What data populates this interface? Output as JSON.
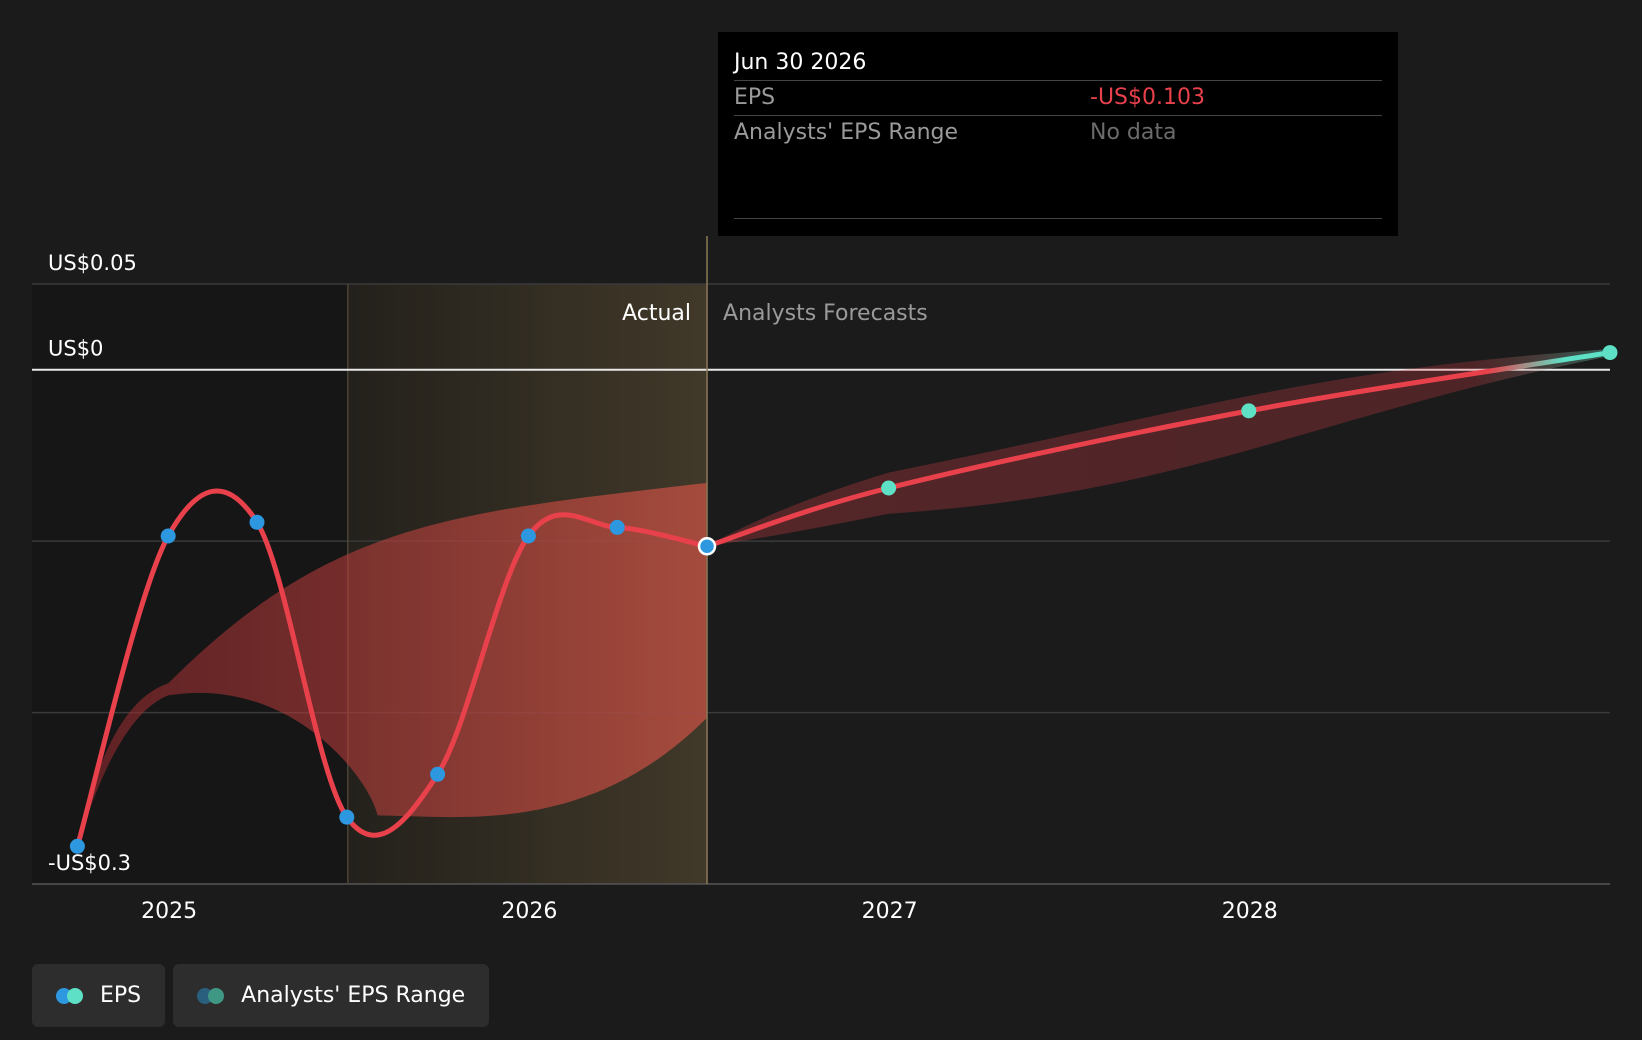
{
  "chart_data": {
    "type": "line",
    "x_ticks": [
      "2025",
      "2026",
      "2027",
      "2028"
    ],
    "y_ticks": [
      "US$0.05",
      "US$0",
      "-US$0.3"
    ],
    "y_tick_values": [
      0.05,
      0,
      -0.3
    ],
    "ylim": [
      -0.3,
      0.05
    ],
    "xlim": [
      "2024-08-15",
      "2028-12-31"
    ],
    "actual_end": "2026-06-30",
    "highlight_start": "2025-07-01",
    "grid": true,
    "regions": {
      "actual": "Actual",
      "forecast": "Analysts Forecasts"
    },
    "series": [
      {
        "name": "EPS",
        "color": "#e8414b",
        "actual_point_color": "#2d97e0",
        "forecast_point_color": "#5de0c5",
        "points": [
          {
            "x": "2024-09-30",
            "y": -0.278
          },
          {
            "x": "2024-12-31",
            "y": -0.097
          },
          {
            "x": "2025-03-31",
            "y": -0.089
          },
          {
            "x": "2025-06-30",
            "y": -0.261
          },
          {
            "x": "2025-09-30",
            "y": -0.236
          },
          {
            "x": "2025-12-31",
            "y": -0.097
          },
          {
            "x": "2026-03-31",
            "y": -0.092
          },
          {
            "x": "2026-06-30",
            "y": -0.103
          },
          {
            "x": "2026-12-31",
            "y": -0.069
          },
          {
            "x": "2027-12-31",
            "y": -0.024
          },
          {
            "x": "2028-12-31",
            "y": 0.01
          }
        ]
      },
      {
        "name": "Analysts' EPS Range",
        "color": "#e8414b",
        "upper": [
          {
            "x": "2024-12-31",
            "y": -0.183
          },
          {
            "x": "2026-06-30",
            "y": -0.066
          },
          {
            "x": "2028-12-31",
            "y": 0.012
          }
        ],
        "lower": [
          {
            "x": "2024-12-31",
            "y": -0.19
          },
          {
            "x": "2026-06-30",
            "y": -0.203
          },
          {
            "x": "2028-12-31",
            "y": 0.008
          }
        ]
      }
    ]
  },
  "tooltip": {
    "date": "Jun 30 2026",
    "rows": [
      {
        "label": "EPS",
        "value": "-US$0.103"
      },
      {
        "label": "Analysts' EPS Range",
        "value": "No data"
      }
    ]
  },
  "legend": [
    {
      "label": "EPS",
      "colors": [
        "#2d97e0",
        "#5de0c5"
      ]
    },
    {
      "label": "Analysts' EPS Range",
      "colors": [
        "#2b5f7e",
        "#3f9883"
      ]
    }
  ]
}
